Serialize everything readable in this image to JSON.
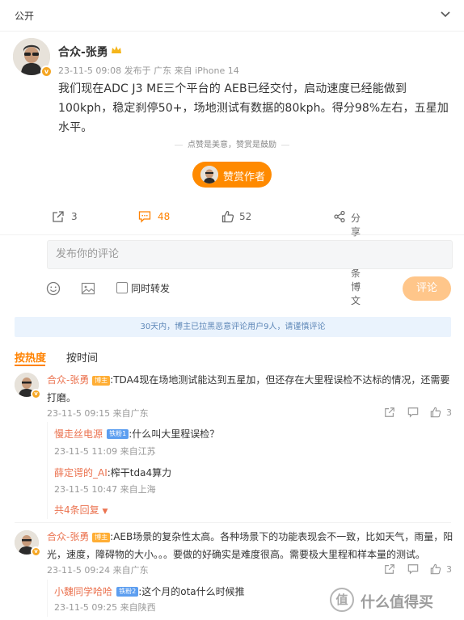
{
  "topbar": {
    "visibility": "公开"
  },
  "post": {
    "author": "合众-张勇",
    "meta": "23-11-5 09:08  发布于 广东  来自 iPhone 14",
    "text": "我们现在ADC J3 ME三个平台的 AEB已经交付，启动速度已经能做到100kph，稳定刹停50+，场地测试有数据的80kph。得分98%左右，五星加水平。",
    "tip": "点赞是美意，赞赏是鼓励",
    "reward_label": "赞赏作者",
    "actions": {
      "forward": "3",
      "comments": "48",
      "likes": "52",
      "share": "分享这三条博文"
    }
  },
  "composer": {
    "placeholder": "发布你的评论",
    "repost_label": "同时转发",
    "submit_label": "评论"
  },
  "notice": "30天内，博主已拉黑恶意评论用户9人，请谨慎评论",
  "sort": {
    "hot": "按热度",
    "time": "按时间"
  },
  "comments": [
    {
      "name": "合众-张勇",
      "badge": "博主",
      "text": ":TDA4现在场地测试能达到五星加，但还存在大里程误检不达标的情况，还需要打磨。",
      "meta": "23-11-5 09:15 来自广东",
      "likes": "3",
      "replies": [
        {
          "name": "慢走丝电源",
          "badge": "铁粉1",
          "text": ":什么叫大里程误检？",
          "meta": "23-11-5 11:09 来自江苏"
        },
        {
          "name": "薛定谔的_AI",
          "badge": "",
          "text": ":榨干tda4算力",
          "meta": "23-11-5 10:47 来自上海"
        }
      ],
      "more": "共4条回复"
    },
    {
      "name": "合众-张勇",
      "badge": "博主",
      "text": ":AEB场景的复杂性太高。各种场景下的功能表现会不一致，比如天气，雨量，阳光，速度，障碍物的大小。。。要做的好确实是难度很高。需要极大里程和样本量的测试。",
      "meta": "23-11-5 09:24 来自广东",
      "likes": "3",
      "replies": [
        {
          "name": "小魏同学哈哈",
          "badge": "铁粉2",
          "text": ":这个月的ota什么时候推",
          "meta": "23-11-5 09:25 来自陕西"
        }
      ]
    }
  ],
  "watermark": {
    "glyph": "值",
    "text": "什么值得买"
  },
  "colors": {
    "accent": "#ff8200",
    "link": "#eb7350",
    "reward": "#ff8a00"
  }
}
